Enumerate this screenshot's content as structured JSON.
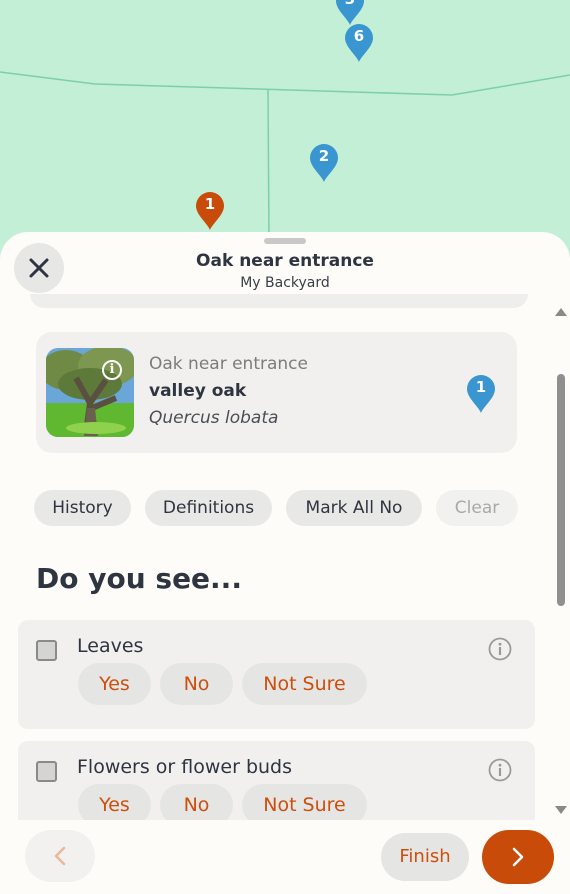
{
  "colors": {
    "map_bg": "#c2efd6",
    "map_line": "#7dcfac",
    "pin_blue": "#3a96d1",
    "pin_orange": "#c94b09",
    "accent": "#cc4f0d"
  },
  "map": {
    "pins": [
      {
        "label": "3",
        "color": "blue"
      },
      {
        "label": "6",
        "color": "blue"
      },
      {
        "label": "2",
        "color": "blue"
      },
      {
        "label": "1",
        "color": "orange"
      }
    ]
  },
  "header": {
    "title": "Oak near entrance",
    "subtitle": "My Backyard",
    "close_icon": "close-icon"
  },
  "plant": {
    "nickname": "Oak near entrance",
    "common_name": "valley oak",
    "scientific_name": "Quercus lobata",
    "info_glyph": "i",
    "pin_label": "1"
  },
  "chips": {
    "history": "History",
    "definitions": "Definitions",
    "mark_all_no": "Mark All No",
    "clear": "Clear"
  },
  "question": {
    "heading": "Do you see..."
  },
  "phenophases": [
    {
      "label": "Leaves",
      "answers": [
        "Yes",
        "No",
        "Not Sure"
      ]
    },
    {
      "label": "Flowers or flower buds",
      "answers": [
        "Yes",
        "No",
        "Not Sure"
      ]
    }
  ],
  "footer": {
    "finish_label": "Finish",
    "back_icon": "chevron-left-icon",
    "next_icon": "chevron-right-icon"
  }
}
